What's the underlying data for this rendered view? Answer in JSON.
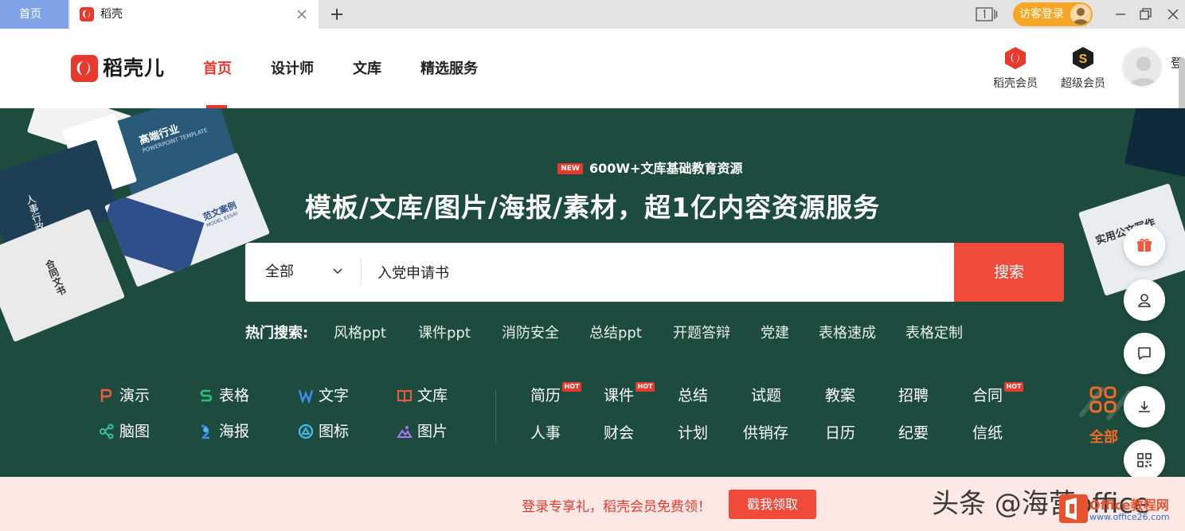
{
  "browser": {
    "home_tab": "首页",
    "active_tab": "稻壳",
    "guest_login": "访客登录"
  },
  "header": {
    "logo_text": "稻壳儿",
    "nav": [
      "首页",
      "设计师",
      "文库",
      "精选服务"
    ],
    "member_docer": "稻壳会员",
    "member_super": "超级会员",
    "login": "登"
  },
  "hero": {
    "badge": "NEW",
    "subtitle": "600W+文库基础教育资源",
    "title": "模板/文库/图片/海报/素材，超1亿内容资源服务",
    "search": {
      "category": "全部",
      "query": "入党申请书",
      "button": "搜索"
    },
    "hot_label": "热门搜索:",
    "hot_searches": [
      "风格ppt",
      "课件ppt",
      "消防安全",
      "总结ppt",
      "开题答辩",
      "党建",
      "表格速成",
      "表格定制"
    ],
    "categories": [
      {
        "label": "演示",
        "icon": "presentation-icon",
        "color": "#f05a3c"
      },
      {
        "label": "表格",
        "icon": "spreadsheet-icon",
        "color": "#2fc27a"
      },
      {
        "label": "文字",
        "icon": "word-icon",
        "color": "#3e8cf0"
      },
      {
        "label": "文库",
        "icon": "library-book-icon",
        "color": "#f05a3c"
      },
      {
        "label": "脑图",
        "icon": "mindmap-icon",
        "color": "#2fc2a8"
      },
      {
        "label": "海报",
        "icon": "poster-icon",
        "color": "#3e8cf0"
      },
      {
        "label": "图标",
        "icon": "icon-library-icon",
        "color": "#3ec0f0"
      },
      {
        "label": "图片",
        "icon": "image-icon",
        "color": "#a87af0"
      }
    ],
    "hot_tag": "HOT",
    "doc_types": [
      {
        "label": "简历",
        "hot": true
      },
      {
        "label": "课件",
        "hot": true
      },
      {
        "label": "总结",
        "hot": false
      },
      {
        "label": "试题",
        "hot": false
      },
      {
        "label": "教案",
        "hot": false
      },
      {
        "label": "招聘",
        "hot": false
      },
      {
        "label": "合同",
        "hot": true
      },
      {
        "label": "人事",
        "hot": false
      },
      {
        "label": "财会",
        "hot": false
      },
      {
        "label": "计划",
        "hot": false
      },
      {
        "label": "供销存",
        "hot": false
      },
      {
        "label": "日历",
        "hot": false
      },
      {
        "label": "纪要",
        "hot": false
      },
      {
        "label": "信纸",
        "hot": false
      }
    ],
    "all_label": "全部",
    "deco": {
      "card_1": "高端行业",
      "card_1_sub": "POWERPOINT TEMPLATE",
      "card_2": "范文案例",
      "card_2_sub": "MODEL ESSAY",
      "card_3": "人事行政",
      "card_4": "合同文书",
      "card_5": "实用公文写作"
    }
  },
  "side_tools": [
    "gift-icon",
    "user-icon",
    "feedback-icon",
    "download-icon",
    "qrcode-icon"
  ],
  "banner": {
    "text": "登录专享礼，稻壳会员免费领！",
    "button": "戳我领取",
    "watermark": "头条 @海营office",
    "wm_brand": "Office教程网",
    "wm_site": "www.office26.com"
  },
  "colors": {
    "brand_red": "#e8392e",
    "hero_green": "#1d4c3e",
    "search_button": "#f04a3a",
    "guest_orange": "#f5a623"
  }
}
